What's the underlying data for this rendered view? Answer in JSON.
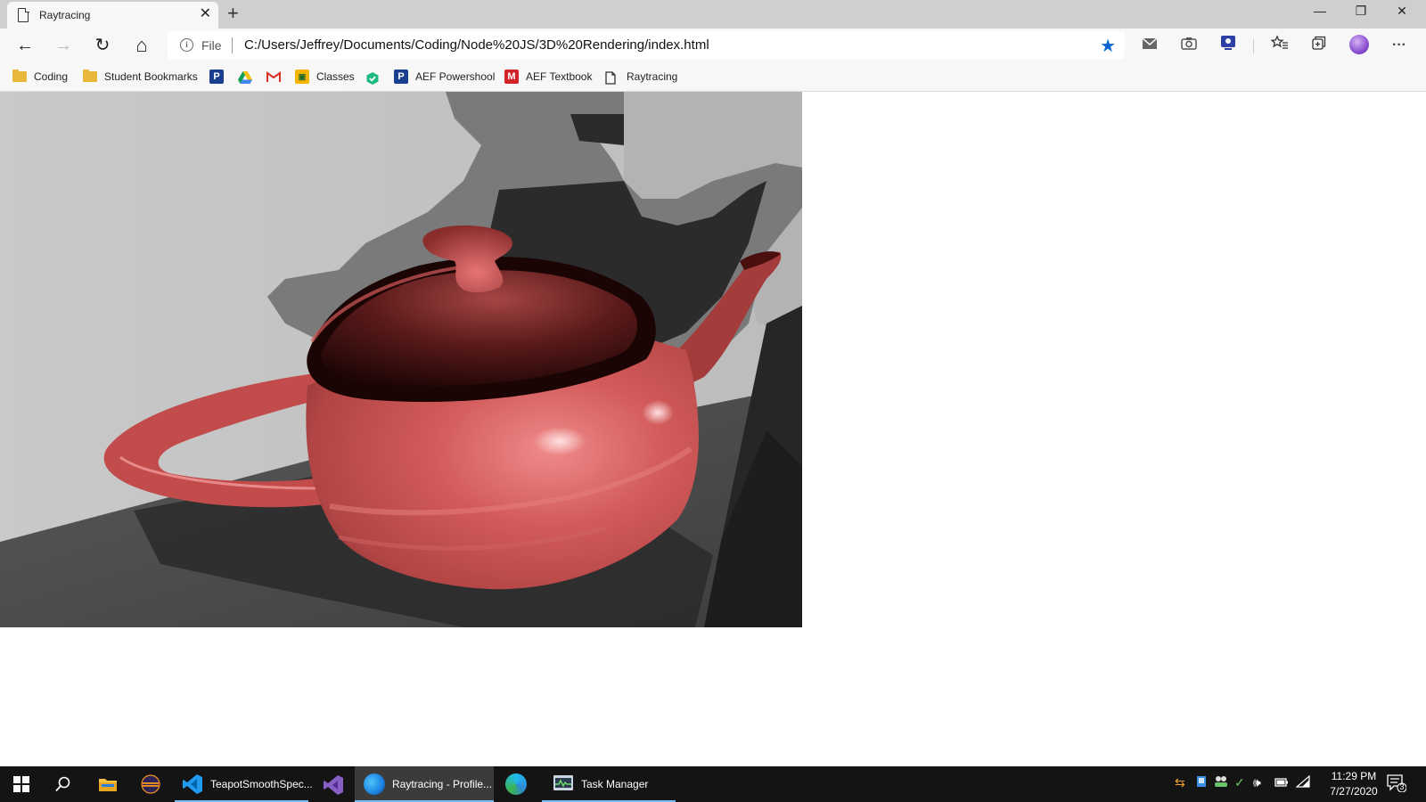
{
  "browser": {
    "tab_title": "Raytracing",
    "tab_close": "✕",
    "new_tab": "+",
    "window_controls": {
      "minimize": "—",
      "restore": "❐",
      "close": "✕"
    }
  },
  "toolbar": {
    "back": "←",
    "forward": "→",
    "refresh": "↻",
    "home": "⌂",
    "info_glyph": "i",
    "scheme": "File",
    "url": "C:/Users/Jeffrey/Documents/Coding/Node%20JS/3D%20Rendering/index.html",
    "favorite": "★",
    "more": "···"
  },
  "bookmarks": [
    {
      "label": "Coding",
      "icon": "folder-icon"
    },
    {
      "label": "Student Bookmarks",
      "icon": "folder-icon"
    },
    {
      "label": "",
      "icon": "pearson-icon"
    },
    {
      "label": "",
      "icon": "google-drive-icon"
    },
    {
      "label": "",
      "icon": "gmail-icon"
    },
    {
      "label": "Classes",
      "icon": "classroom-icon"
    },
    {
      "label": "",
      "icon": "green-app-icon"
    },
    {
      "label": "AEF Powershool",
      "icon": "pearson-icon"
    },
    {
      "label": "AEF Textbook",
      "icon": "mcgraw-hill-icon"
    },
    {
      "label": "Raytracing",
      "icon": "page-icon"
    }
  ],
  "taskbar": {
    "apps": [
      {
        "label": "TeapotSmoothSpec...",
        "icon": "vscode-icon"
      },
      {
        "label": "Raytracing - Profile...",
        "icon": "edge-beta-icon"
      },
      {
        "label": "Task Manager",
        "icon": "task-manager-icon"
      }
    ],
    "clock_time": "11:29 PM",
    "clock_date": "7/27/2020",
    "notification_count": "3"
  },
  "colors": {
    "accent": "#0a66d0",
    "teapot": "#c94a4a",
    "taskbar": "#141414",
    "taskbar_indicator": "#76b9ed"
  }
}
